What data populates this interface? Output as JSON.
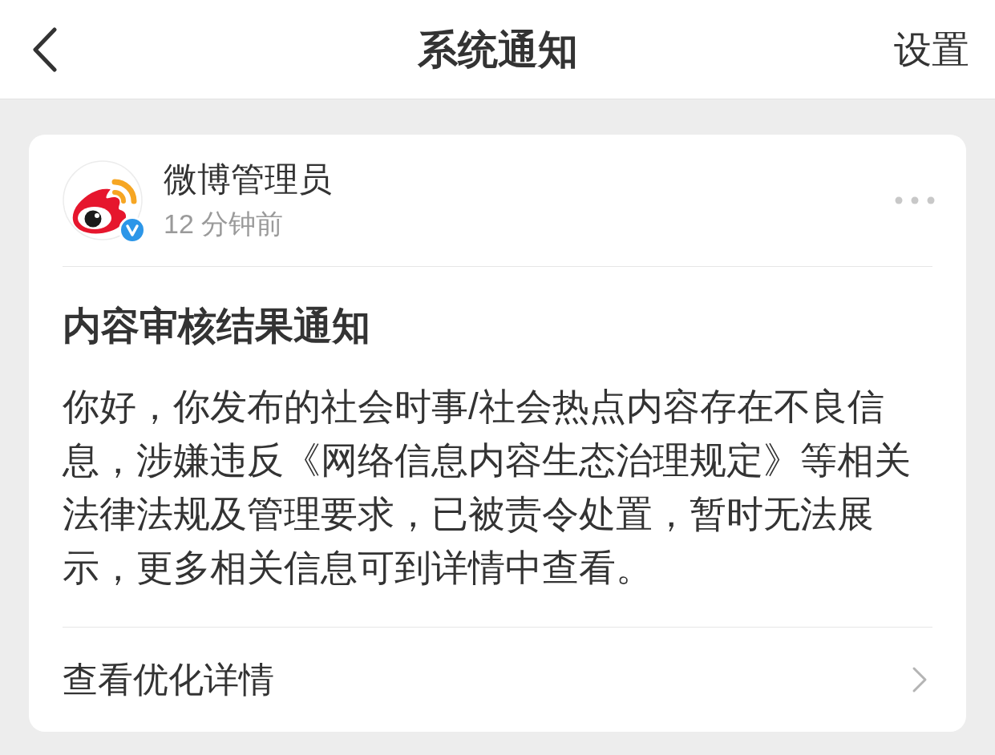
{
  "header": {
    "title": "系统通知",
    "action": "设置"
  },
  "notice": {
    "sender": {
      "name": "微博管理员",
      "verified": true,
      "time": "12 分钟前"
    },
    "title": "内容审核结果通知",
    "body": "你好，你发布的社会时事/社会热点内容存在不良信息，涉嫌违反《网络信息内容生态治理规定》等相关法律法规及管理要求，已被责令处置，暂时无法展示，更多相关信息可到详情中查看。",
    "link": "查看优化详情"
  }
}
